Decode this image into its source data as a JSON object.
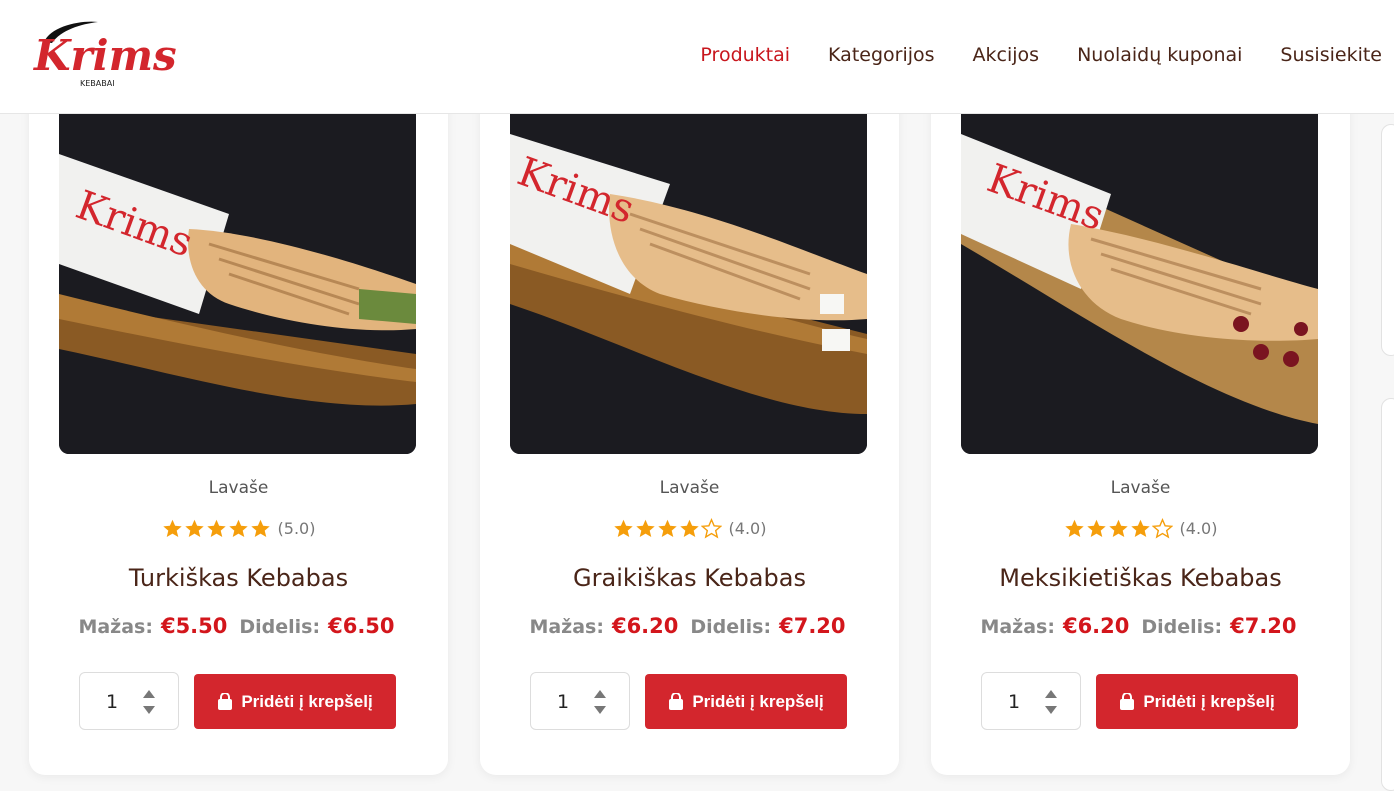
{
  "brand": {
    "name": "Krims",
    "sub": "KEBABAI"
  },
  "nav": [
    {
      "label": "Produktai",
      "active": true
    },
    {
      "label": "Kategorijos",
      "active": false
    },
    {
      "label": "Akcijos",
      "active": false
    },
    {
      "label": "Nuolaidų kuponai",
      "active": false
    },
    {
      "label": "Susisiekite",
      "active": false
    }
  ],
  "colors": {
    "accent": "#d3262d",
    "price": "#d3161c",
    "title": "#4a2518",
    "star": "#f59e0b"
  },
  "products": [
    {
      "category": "Lavaše",
      "rating": 5,
      "rating_text": "(5.0)",
      "name": "Turkiškas Kebabas",
      "small_label": "Mažas:",
      "small_price": "€5.50",
      "large_label": "Didelis:",
      "large_price": "€6.50",
      "qty": "1",
      "add_label": "Pridėti į krepšelį"
    },
    {
      "category": "Lavaše",
      "rating": 4,
      "rating_text": "(4.0)",
      "name": "Graikiškas Kebabas",
      "small_label": "Mažas:",
      "small_price": "€6.20",
      "large_label": "Didelis:",
      "large_price": "€7.20",
      "qty": "1",
      "add_label": "Pridėti į krepšelį"
    },
    {
      "category": "Lavaše",
      "rating": 4,
      "rating_text": "(4.0)",
      "name": "Meksikietiškas Kebabas",
      "small_label": "Mažas:",
      "small_price": "€6.20",
      "large_label": "Didelis:",
      "large_price": "€7.20",
      "qty": "1",
      "add_label": "Pridėti į krepšelį"
    }
  ]
}
